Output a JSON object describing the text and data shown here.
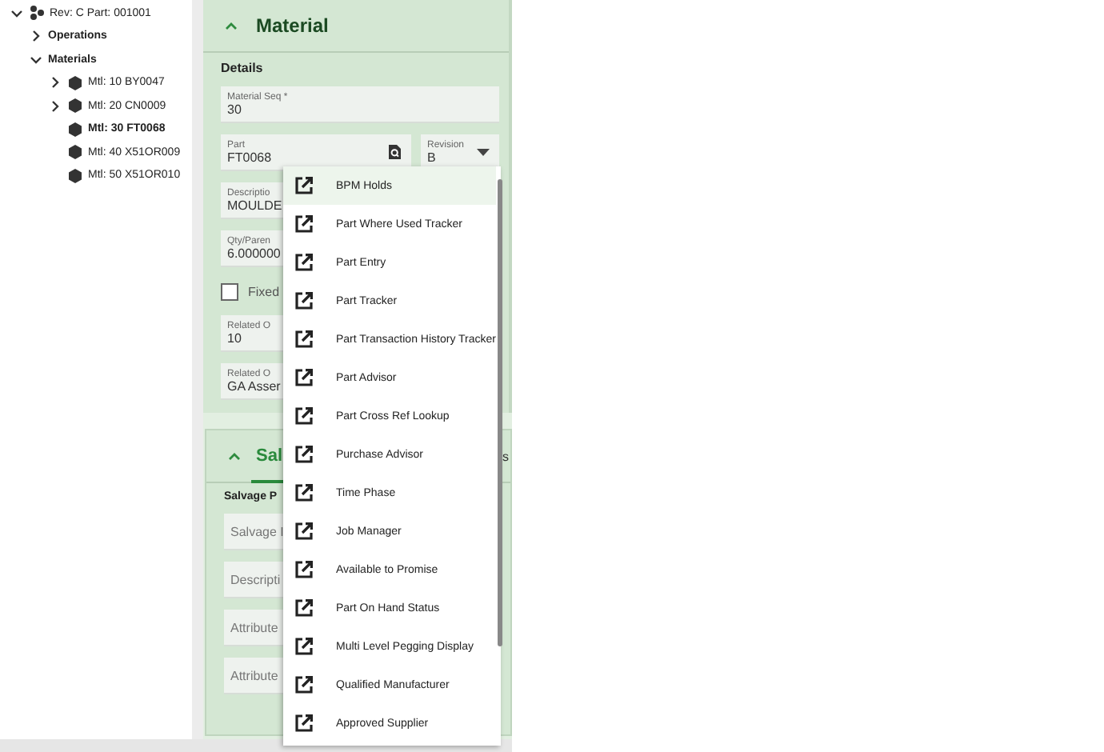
{
  "tree": {
    "items": [
      {
        "label": "Rev: C Part: 001001",
        "kind": "branch",
        "expanded": true,
        "selected": false,
        "children": [
          {
            "label": "Operations",
            "kind": "branch",
            "expanded": false,
            "selected": false
          },
          {
            "label": "Materials",
            "kind": "branch",
            "expanded": true,
            "selected": false,
            "children": [
              {
                "label": "Mtl: 10 BY0047",
                "kind": "branch",
                "expanded": false,
                "selected": false
              },
              {
                "label": "Mtl: 20 CN0009",
                "kind": "branch",
                "expanded": false,
                "selected": false
              },
              {
                "label": "Mtl: 30 FT0068",
                "kind": "leaf",
                "selected": true
              },
              {
                "label": "Mtl: 40 X51OR009",
                "kind": "leaf",
                "selected": false
              },
              {
                "label": "Mtl: 50 X51OR010",
                "kind": "leaf",
                "selected": false
              }
            ]
          }
        ]
      }
    ]
  },
  "material": {
    "title": "Material",
    "expanded": true,
    "section": "Details",
    "rows": [
      [
        {
          "kind": "text",
          "label": "Material Seq *",
          "value": "30"
        }
      ],
      [
        {
          "kind": "lookup",
          "label": "Part",
          "value": "FT0068"
        },
        {
          "kind": "dropdown",
          "label": "Revision",
          "value": "B"
        }
      ],
      [
        {
          "kind": "text",
          "label": "Descriptio",
          "value": "MOULDE"
        }
      ],
      [
        {
          "kind": "text",
          "label": "Qty/Paren",
          "value": "6.000000"
        }
      ],
      [
        {
          "kind": "checkbox",
          "label": "Fixed",
          "checked": false
        }
      ],
      [
        {
          "kind": "text",
          "label": "Related O",
          "value": "10"
        }
      ],
      [
        {
          "kind": "text",
          "label": "Related O",
          "value": "GA Asser"
        }
      ]
    ]
  },
  "salvage": {
    "expanded": true,
    "tabs": [
      {
        "label": "Sal",
        "selected": true
      },
      {
        "label": "s",
        "selected": false
      }
    ],
    "section": "Salvage P",
    "fields": [
      {
        "placeholder": "Salvage I"
      },
      {
        "placeholder": "Descripti"
      },
      {
        "placeholder": "Attribute"
      },
      {
        "placeholder": "Attribute"
      }
    ]
  },
  "menu": {
    "items": [
      {
        "label": "BPM Holds",
        "highlighted": true
      },
      {
        "label": "Part Where Used Tracker",
        "highlighted": false
      },
      {
        "label": "Part Entry",
        "highlighted": false
      },
      {
        "label": "Part Tracker",
        "highlighted": false
      },
      {
        "label": "Part Transaction History Tracker",
        "highlighted": false
      },
      {
        "label": "Part Advisor",
        "highlighted": false
      },
      {
        "label": "Part Cross Ref Lookup",
        "highlighted": false
      },
      {
        "label": "Purchase Advisor",
        "highlighted": false
      },
      {
        "label": "Time Phase",
        "highlighted": false
      },
      {
        "label": "Job Manager",
        "highlighted": false
      },
      {
        "label": "Available to Promise",
        "highlighted": false
      },
      {
        "label": "Part On Hand Status",
        "highlighted": false
      },
      {
        "label": "Multi Level Pegging Display",
        "highlighted": false
      },
      {
        "label": "Qualified Manufacturer",
        "highlighted": false
      },
      {
        "label": "Approved Supplier",
        "highlighted": false
      }
    ]
  }
}
